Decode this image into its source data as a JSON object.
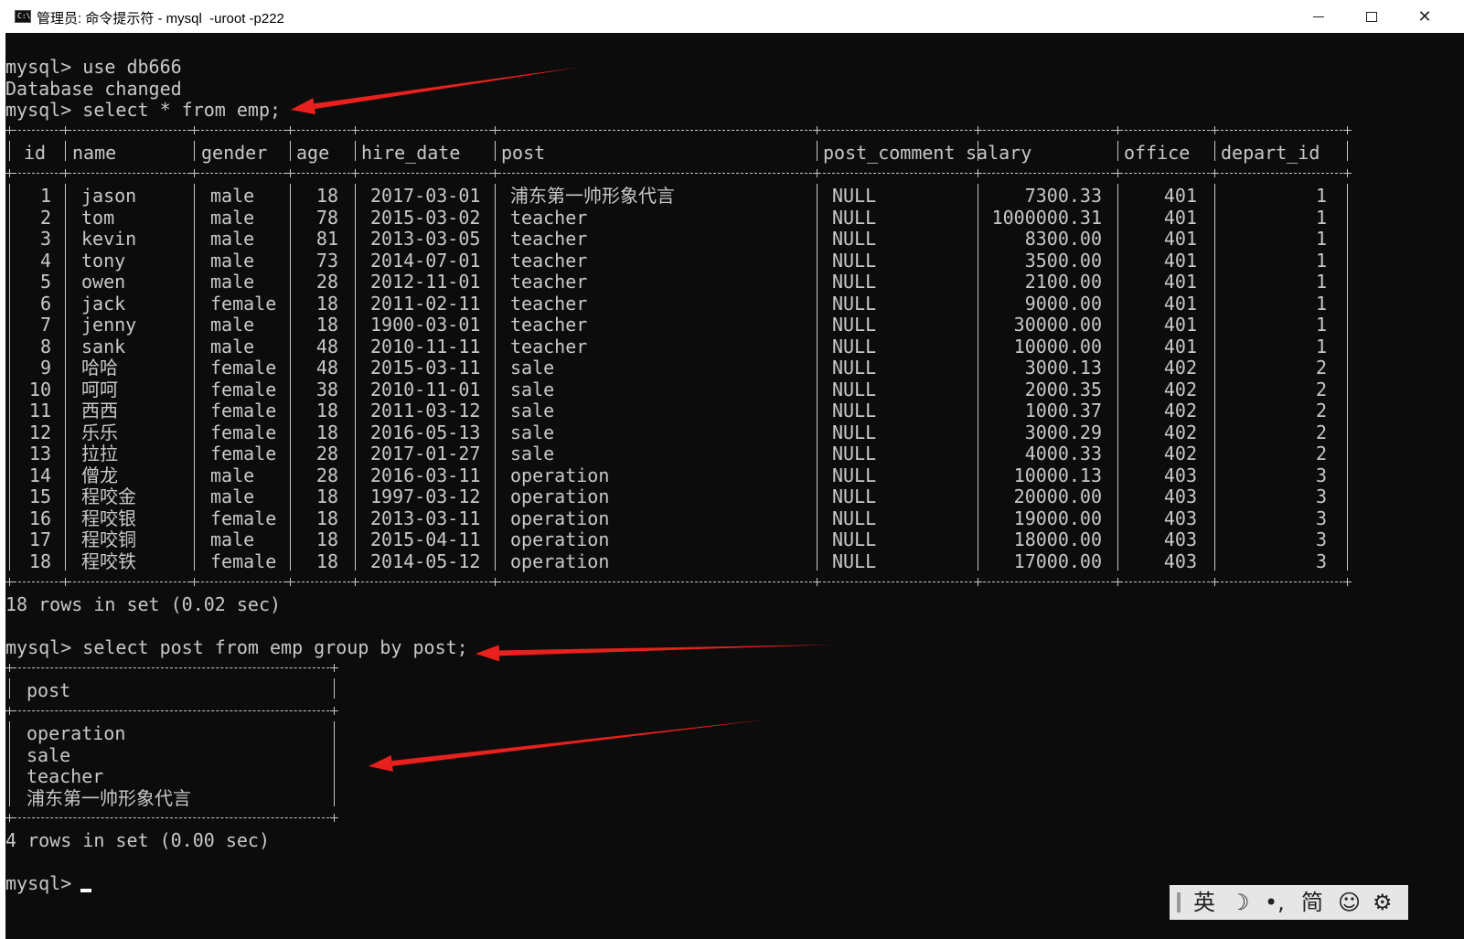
{
  "window": {
    "title": "管理员: 命令提示符 - mysql  -uroot -p222",
    "icon_text": "C:\\",
    "controls": {
      "minimize": "─",
      "maximize": "☐",
      "close": "✕"
    }
  },
  "terminal": {
    "lines": [
      "mysql> use db666",
      "Database changed",
      "mysql> select * from emp;"
    ],
    "emp_headers": [
      "id",
      "name",
      "gender",
      "age",
      "hire_date",
      "post",
      "post_comment",
      "salary",
      "office",
      "depart_id"
    ],
    "emp_rows": [
      [
        "1",
        "jason",
        "male",
        "18",
        "2017-03-01",
        "浦东第一帅形象代言",
        "NULL",
        "7300.33",
        "401",
        "1"
      ],
      [
        "2",
        "tom",
        "male",
        "78",
        "2015-03-02",
        "teacher",
        "NULL",
        "1000000.31",
        "401",
        "1"
      ],
      [
        "3",
        "kevin",
        "male",
        "81",
        "2013-03-05",
        "teacher",
        "NULL",
        "8300.00",
        "401",
        "1"
      ],
      [
        "4",
        "tony",
        "male",
        "73",
        "2014-07-01",
        "teacher",
        "NULL",
        "3500.00",
        "401",
        "1"
      ],
      [
        "5",
        "owen",
        "male",
        "28",
        "2012-11-01",
        "teacher",
        "NULL",
        "2100.00",
        "401",
        "1"
      ],
      [
        "6",
        "jack",
        "female",
        "18",
        "2011-02-11",
        "teacher",
        "NULL",
        "9000.00",
        "401",
        "1"
      ],
      [
        "7",
        "jenny",
        "male",
        "18",
        "1900-03-01",
        "teacher",
        "NULL",
        "30000.00",
        "401",
        "1"
      ],
      [
        "8",
        "sank",
        "male",
        "48",
        "2010-11-11",
        "teacher",
        "NULL",
        "10000.00",
        "401",
        "1"
      ],
      [
        "9",
        "哈哈",
        "female",
        "48",
        "2015-03-11",
        "sale",
        "NULL",
        "3000.13",
        "402",
        "2"
      ],
      [
        "10",
        "呵呵",
        "female",
        "38",
        "2010-11-01",
        "sale",
        "NULL",
        "2000.35",
        "402",
        "2"
      ],
      [
        "11",
        "西西",
        "female",
        "18",
        "2011-03-12",
        "sale",
        "NULL",
        "1000.37",
        "402",
        "2"
      ],
      [
        "12",
        "乐乐",
        "female",
        "18",
        "2016-05-13",
        "sale",
        "NULL",
        "3000.29",
        "402",
        "2"
      ],
      [
        "13",
        "拉拉",
        "female",
        "28",
        "2017-01-27",
        "sale",
        "NULL",
        "4000.33",
        "402",
        "2"
      ],
      [
        "14",
        "僧龙",
        "male",
        "28",
        "2016-03-11",
        "operation",
        "NULL",
        "10000.13",
        "403",
        "3"
      ],
      [
        "15",
        "程咬金",
        "male",
        "18",
        "1997-03-12",
        "operation",
        "NULL",
        "20000.00",
        "403",
        "3"
      ],
      [
        "16",
        "程咬银",
        "female",
        "18",
        "2013-03-11",
        "operation",
        "NULL",
        "19000.00",
        "403",
        "3"
      ],
      [
        "17",
        "程咬铜",
        "male",
        "18",
        "2015-04-11",
        "operation",
        "NULL",
        "18000.00",
        "403",
        "3"
      ],
      [
        "18",
        "程咬铁",
        "female",
        "18",
        "2014-05-12",
        "operation",
        "NULL",
        "17000.00",
        "403",
        "3"
      ]
    ],
    "result1": "18 rows in set (0.02 sec)",
    "query2": "mysql> select post from emp group by post;",
    "post_header": "post",
    "post_rows": [
      "operation",
      "sale",
      "teacher",
      "浦东第一帅形象代言"
    ],
    "result2": "4 rows in set (0.00 sec)",
    "prompt": "mysql>"
  },
  "annotations": {
    "arrow_color": "#e8201e"
  },
  "ime_bar": {
    "lang": "英",
    "moon": "☽",
    "punct": "•,",
    "mode": "简",
    "emoji": "☺",
    "settings": "⚙"
  }
}
